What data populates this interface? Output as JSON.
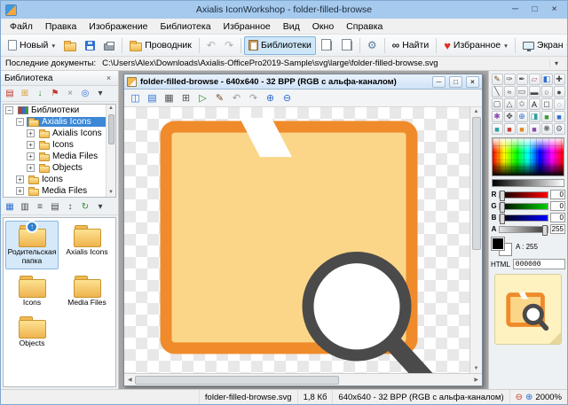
{
  "colors": {
    "accent": "#a6c9ee",
    "accent-border": "#7fa8d0",
    "selection": "#3c87d6",
    "pressed-bg": "#cde6f8",
    "pressed-border": "#84b4dc",
    "folder-fill": "#fcd688",
    "folder-stroke": "#ef8b2b",
    "magnifier": "#4a4a4a",
    "doc-titlebar": "#cfe3f7",
    "mdi-bg": "#a6a6a6",
    "preview-bg": "#fdf2c0"
  },
  "titlebar": {
    "title": "Axialis IconWorkshop - folder-filled-browse",
    "minimize": "─",
    "maximize": "□",
    "close": "×"
  },
  "menubar": {
    "items": [
      "Файл",
      "Правка",
      "Изображение",
      "Библиотека",
      "Избранное",
      "Вид",
      "Окно",
      "Справка"
    ]
  },
  "toolbar": {
    "new_label": "Новый",
    "explorer_label": "Проводник",
    "libraries_label": "Библиотеки",
    "find_label": "Найти",
    "favorites_label": "Избранное",
    "screen_label": "Экран",
    "dropdown": "▾",
    "undo": "↶",
    "redo": "↷",
    "gear": "⚙",
    "heart": "♥",
    "binoculars": "∞",
    "info": "i"
  },
  "recentbar": {
    "label": "Последние документы:",
    "path": "C:\\Users\\Alex\\Downloads\\Axialis-OfficePro2019-Sample\\svg\\large\\folder-filled-browse.svg",
    "dropdown": "▾"
  },
  "library": {
    "title": "Библиотека",
    "close": "×",
    "up_arrow": "↑",
    "toolbar": [
      {
        "name": "new-library",
        "glyph": "▤",
        "color": "#c23b2e"
      },
      {
        "name": "new-folder",
        "glyph": "⊞",
        "color": "#d99a2b"
      },
      {
        "name": "import",
        "glyph": "↓",
        "color": "#2a8a2a"
      },
      {
        "name": "flag",
        "glyph": "⚑",
        "color": "#c23b2e"
      },
      {
        "name": "delete",
        "glyph": "×",
        "color": "#888888"
      },
      {
        "name": "search",
        "glyph": "◎",
        "color": "#2f6fd0"
      },
      {
        "name": "more",
        "glyph": "▾",
        "color": "#444444"
      }
    ],
    "tree": [
      {
        "label": "Библиотеки",
        "box": "−"
      },
      {
        "label": "Axialis Icons",
        "box": "−"
      },
      {
        "label": "Axialis Icons",
        "box": "+"
      },
      {
        "label": "Icons",
        "box": "+"
      },
      {
        "label": "Media Files",
        "box": "+"
      },
      {
        "label": "Objects",
        "box": "+"
      },
      {
        "label": "Icons",
        "box": "+"
      },
      {
        "label": "Media Files",
        "box": "+"
      }
    ],
    "view_toolbar": [
      {
        "name": "large-icons",
        "glyph": "▦",
        "color": "#2f6fd0"
      },
      {
        "name": "small-icons",
        "glyph": "▥",
        "color": "#444444"
      },
      {
        "name": "list-view",
        "glyph": "≡",
        "color": "#444444"
      },
      {
        "name": "details-view",
        "glyph": "▤",
        "color": "#444444"
      },
      {
        "name": "sort",
        "glyph": "↕",
        "color": "#444444"
      },
      {
        "name": "refresh",
        "glyph": "↻",
        "color": "#2a8a2a"
      },
      {
        "name": "filter",
        "glyph": "▾",
        "color": "#444444"
      }
    ],
    "folders": [
      {
        "label": "Родительская папка"
      },
      {
        "label": "Axialis Icons"
      },
      {
        "label": "Icons"
      },
      {
        "label": "Media Files"
      },
      {
        "label": "Objects"
      }
    ]
  },
  "document": {
    "title": "folder-filled-browse - 640x640 - 32 BPP (RGB с альфа-каналом)",
    "minimize": "─",
    "maximize": "□",
    "close": "×",
    "toolbar": [
      {
        "name": "save",
        "glyph": "◫",
        "color": "#2f6fd0"
      },
      {
        "name": "export",
        "glyph": "▤",
        "color": "#2f6fd0"
      },
      {
        "name": "print",
        "glyph": "▦",
        "color": "#555555"
      },
      {
        "name": "grid",
        "glyph": "⊞",
        "color": "#555555"
      },
      {
        "name": "test",
        "glyph": "▷",
        "color": "#2a8a2a"
      },
      {
        "name": "draw",
        "glyph": "✎",
        "color": "#7a4a1e"
      },
      {
        "name": "undo",
        "glyph": "↶",
        "color": "#999999"
      },
      {
        "name": "redo",
        "glyph": "↷",
        "color": "#999999"
      },
      {
        "name": "zoom-in",
        "glyph": "⊕",
        "color": "#2f6fd0"
      },
      {
        "name": "zoom-out",
        "glyph": "⊖",
        "color": "#2f6fd0"
      }
    ]
  },
  "tools": [
    {
      "name": "pencil",
      "glyph": "✎",
      "color": "#7a4a1e"
    },
    {
      "name": "brush",
      "glyph": "✑",
      "color": "#4a4a4a"
    },
    {
      "name": "airbrush",
      "glyph": "✒",
      "color": "#4a4a4a"
    },
    {
      "name": "eraser",
      "glyph": "▱",
      "color": "#c05a92"
    },
    {
      "name": "fill",
      "glyph": "◧",
      "color": "#2f6fd0"
    },
    {
      "name": "color-picker",
      "glyph": "✚",
      "color": "#4a4a4a"
    },
    {
      "name": "line",
      "glyph": "╲",
      "color": "#4a4a4a"
    },
    {
      "name": "curve",
      "glyph": "≈",
      "color": "#4a4a4a"
    },
    {
      "name": "rectangle",
      "glyph": "▭",
      "color": "#4a4a4a"
    },
    {
      "name": "filled-rectangle",
      "glyph": "▬",
      "color": "#4a4a4a"
    },
    {
      "name": "ellipse",
      "glyph": "○",
      "color": "#4a4a4a"
    },
    {
      "name": "filled-ellipse",
      "glyph": "●",
      "color": "#4a4a4a"
    },
    {
      "name": "rounded-rectangle",
      "glyph": "▢",
      "color": "#4a4a4a"
    },
    {
      "name": "polygon",
      "glyph": "△",
      "color": "#4a4a4a"
    },
    {
      "name": "star",
      "glyph": "✩",
      "color": "#4a4a4a"
    },
    {
      "name": "text",
      "glyph": "A",
      "color": "#1a1a1a"
    },
    {
      "name": "select-rectangle",
      "glyph": "◻",
      "color": "#4a4a4a"
    },
    {
      "name": "select-lasso",
      "glyph": "◌",
      "color": "#4a4a4a"
    },
    {
      "name": "magic-wand",
      "glyph": "✱",
      "color": "#8a4ab0"
    },
    {
      "name": "move",
      "glyph": "✥",
      "color": "#4a4a4a"
    },
    {
      "name": "zoom",
      "glyph": "⊕",
      "color": "#2f6fd0"
    },
    {
      "name": "gradient",
      "glyph": "◨",
      "color": "#2aa0a0"
    },
    {
      "name": "swatch-green",
      "glyph": "■",
      "color": "#3a9d3a"
    },
    {
      "name": "swatch-blue",
      "glyph": "■",
      "color": "#2f6fd0"
    },
    {
      "name": "swatch-teal",
      "glyph": "■",
      "color": "#2aa0a0"
    },
    {
      "name": "swatch-red",
      "glyph": "■",
      "color": "#c23b2e"
    },
    {
      "name": "swatch-orange",
      "glyph": "■",
      "color": "#e08a2a"
    },
    {
      "name": "swatch-purple",
      "glyph": "■",
      "color": "#8a4ab0"
    },
    {
      "name": "blur",
      "glyph": "❋",
      "color": "#4a4a4a"
    },
    {
      "name": "effects",
      "glyph": "⚙",
      "color": "#5a6a7a"
    }
  ],
  "color_panel": {
    "r_label": "R",
    "r_value": "0",
    "g_label": "G",
    "g_value": "0",
    "b_label": "B",
    "b_value": "0",
    "a_label": "A",
    "a_value": "255",
    "alpha_text": "A : 255",
    "html_label": "HTML",
    "html_value": "000000"
  },
  "statusbar": {
    "filename": "folder-filled-browse.svg",
    "filesize": "1,8 Кб",
    "format": "640x640 - 32 BPP (RGB с альфа-каналом)",
    "zoom_out": "⊖",
    "zoom_in": "⊕",
    "zoom": "2000%"
  }
}
